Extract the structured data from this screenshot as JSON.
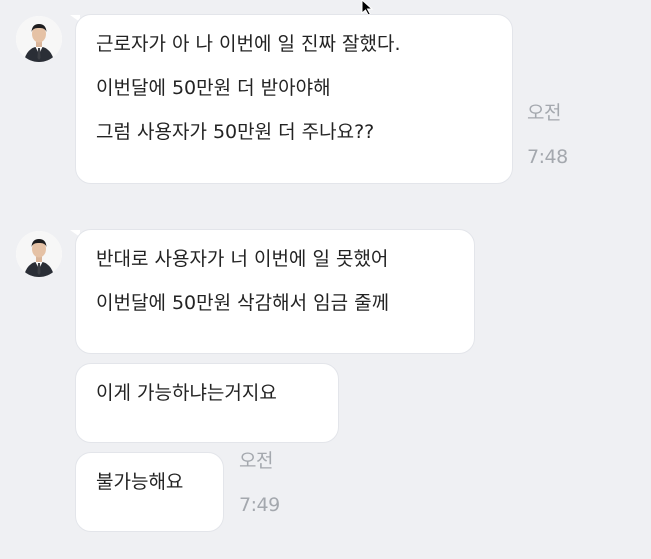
{
  "messages": [
    {
      "lines": [
        "근로자가 아 나 이번에 일 진짜 잘했다.",
        "이번달에 50만원 더 받아야해",
        "그럼 사용자가 50만원 더 주나요??"
      ],
      "meta": {
        "ampm": "오전",
        "time": "7:48"
      }
    },
    {
      "lines": [
        "반대로 사용자가 너 이번에 일 못했어",
        "이번달에 50만원 삭감해서 임금 줄께"
      ]
    },
    {
      "lines": [
        "이게 가능하냐는거지요"
      ]
    },
    {
      "lines": [
        "불가능해요"
      ],
      "meta": {
        "ampm": "오전",
        "time": "7:49"
      }
    }
  ],
  "icons": {
    "avatar": "profile-photo-man-in-suit",
    "cursor": "mouse-pointer"
  },
  "colors": {
    "background": "#eff0f3",
    "bubble": "#ffffff",
    "text": "#232323",
    "timestamp": "#a4a8ae"
  }
}
